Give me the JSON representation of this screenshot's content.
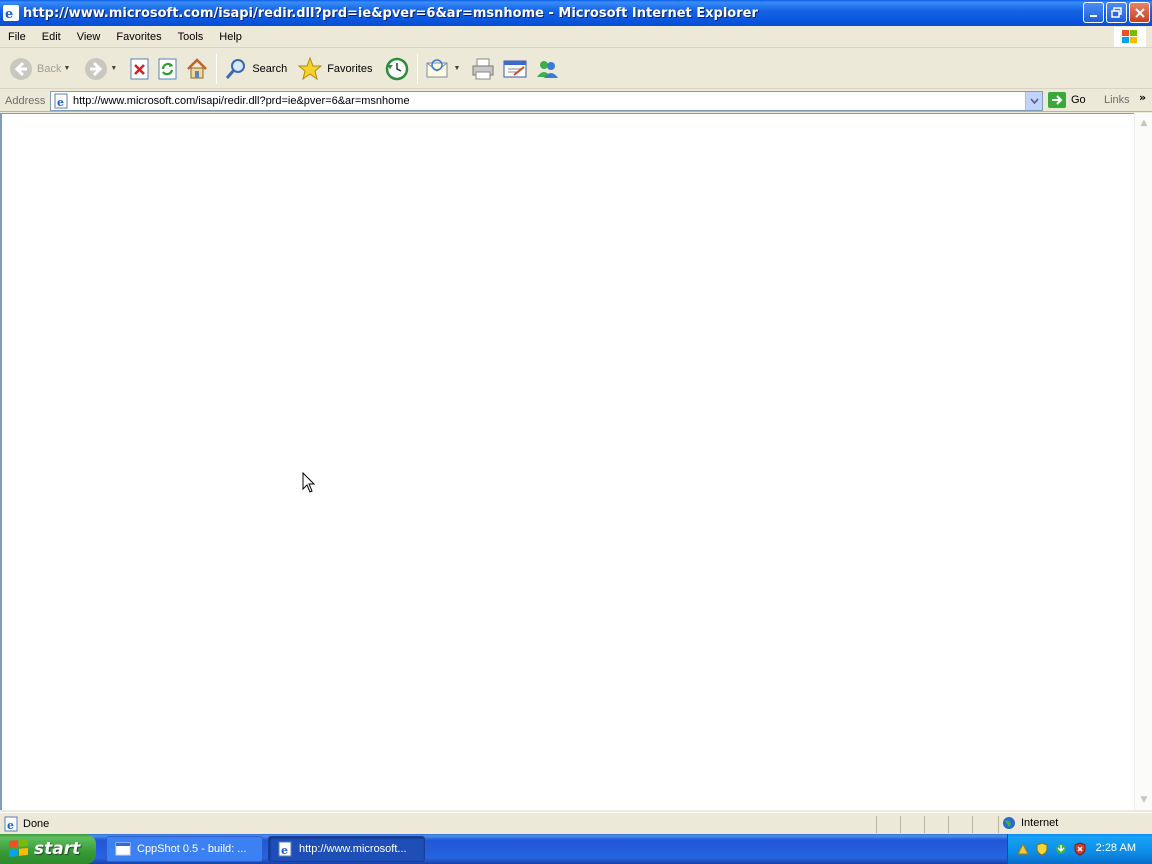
{
  "window": {
    "title": "http://www.microsoft.com/isapi/redir.dll?prd=ie&pver=6&ar=msnhome - Microsoft Internet Explorer"
  },
  "menu": {
    "items": [
      "File",
      "Edit",
      "View",
      "Favorites",
      "Tools",
      "Help"
    ]
  },
  "toolbar": {
    "back_label": "Back",
    "search_label": "Search",
    "favorites_label": "Favorites"
  },
  "address": {
    "label": "Address",
    "url": "http://www.microsoft.com/isapi/redir.dll?prd=ie&pver=6&ar=msnhome",
    "go_label": "Go",
    "links_label": "Links"
  },
  "status": {
    "text": "Done",
    "zone": "Internet"
  },
  "taskbar": {
    "start_label": "start",
    "tasks": [
      {
        "label": "CppShot 0.5 - build: ..."
      },
      {
        "label": "http://www.microsoft..."
      }
    ],
    "clock": "2:28 AM"
  },
  "colors": {
    "titlebar_blue": "#0b55dc",
    "chrome_beige": "#ece9d8",
    "start_green": "#379a37"
  }
}
